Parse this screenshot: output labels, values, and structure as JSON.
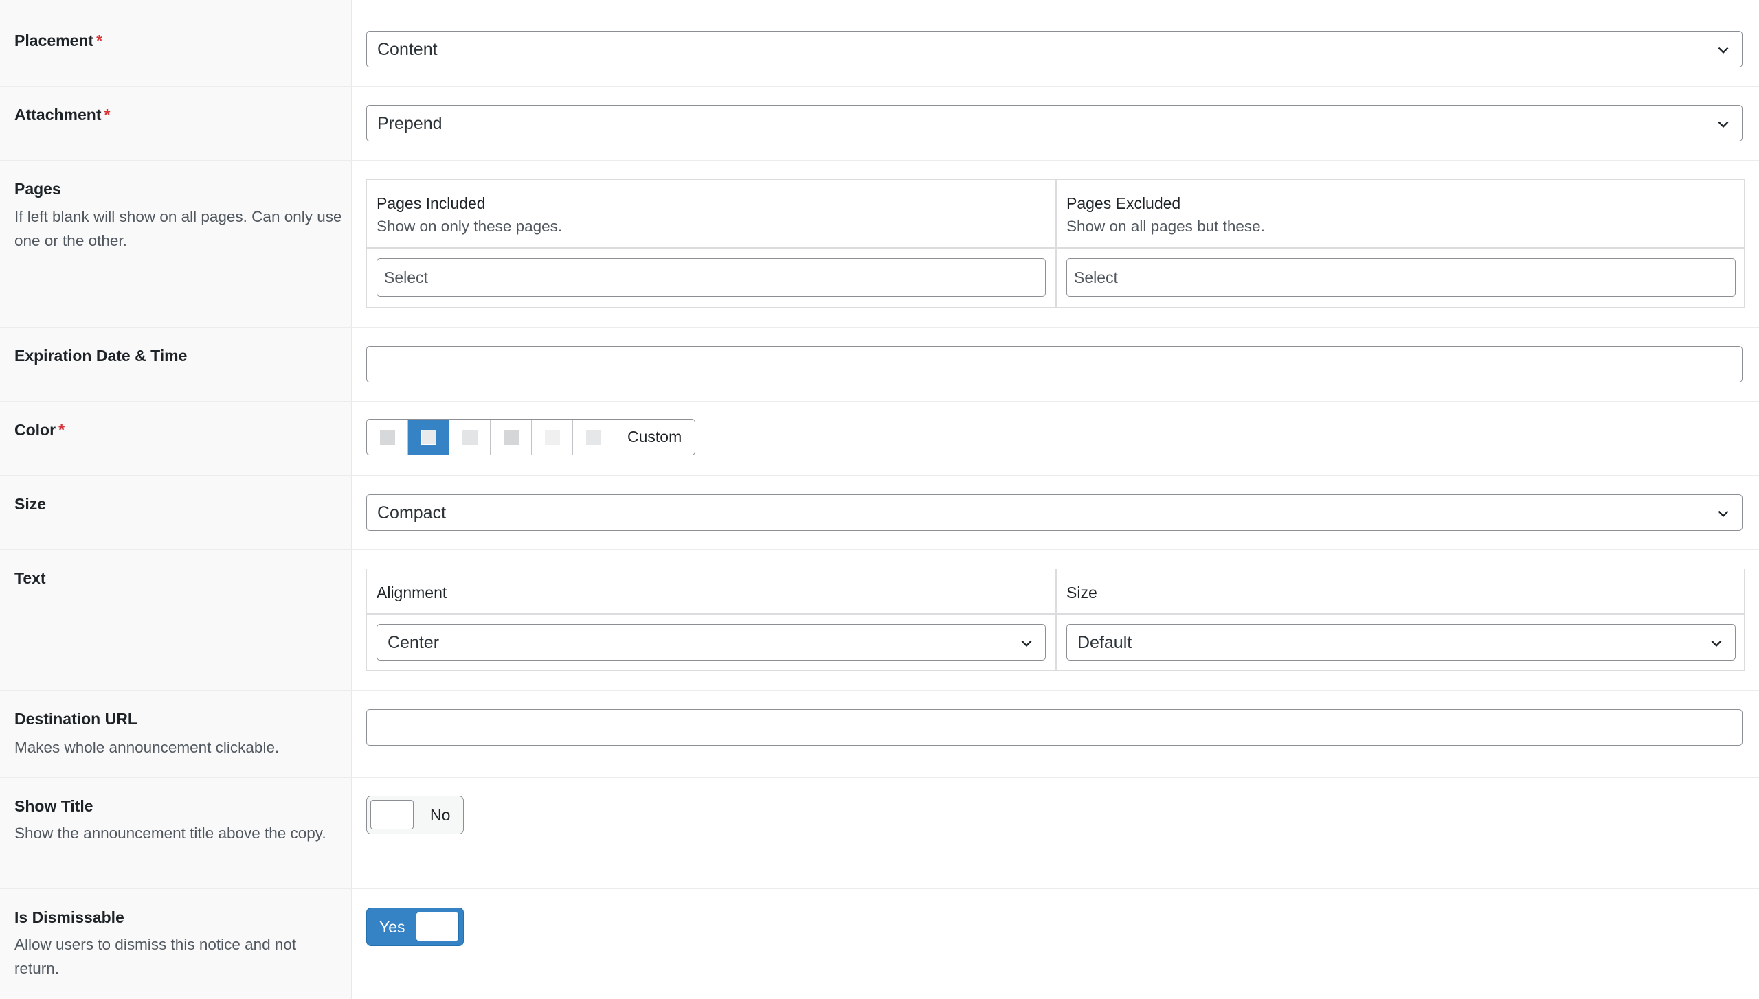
{
  "placement": {
    "label": "Placement",
    "required": "*",
    "value": "Content"
  },
  "attachment": {
    "label": "Attachment",
    "required": "*",
    "value": "Prepend"
  },
  "pages": {
    "label": "Pages",
    "description": "If left blank will show on all pages. Can only use one or the other.",
    "included": {
      "title": "Pages Included",
      "description": "Show on only these pages.",
      "placeholder": "Select"
    },
    "excluded": {
      "title": "Pages Excluded",
      "description": "Show on all pages but these.",
      "placeholder": "Select"
    }
  },
  "expiration": {
    "label": "Expiration Date & Time",
    "value": ""
  },
  "color": {
    "label": "Color",
    "required": "*",
    "swatches": [
      "#d7d8da",
      "#e9eaec",
      "#e3e4e6",
      "#d5d6d8",
      "#f0f0f1",
      "#e6e7e8"
    ],
    "selected_index": 1,
    "custom_label": "Custom"
  },
  "size": {
    "label": "Size",
    "value": "Compact"
  },
  "text": {
    "label": "Text",
    "alignment": {
      "title": "Alignment",
      "value": "Center"
    },
    "size": {
      "title": "Size",
      "value": "Default"
    }
  },
  "destination": {
    "label": "Destination URL",
    "description": "Makes whole announcement clickable.",
    "value": ""
  },
  "show_title": {
    "label": "Show Title",
    "description": "Show the announcement title above the copy.",
    "state": "No"
  },
  "dismissable": {
    "label": "Is Dismissable",
    "description": "Allow users to dismiss this notice and not return.",
    "state": "Yes"
  },
  "colors": {
    "accent": "#3582c4",
    "required": "#d63638",
    "border": "#8c8f94"
  }
}
